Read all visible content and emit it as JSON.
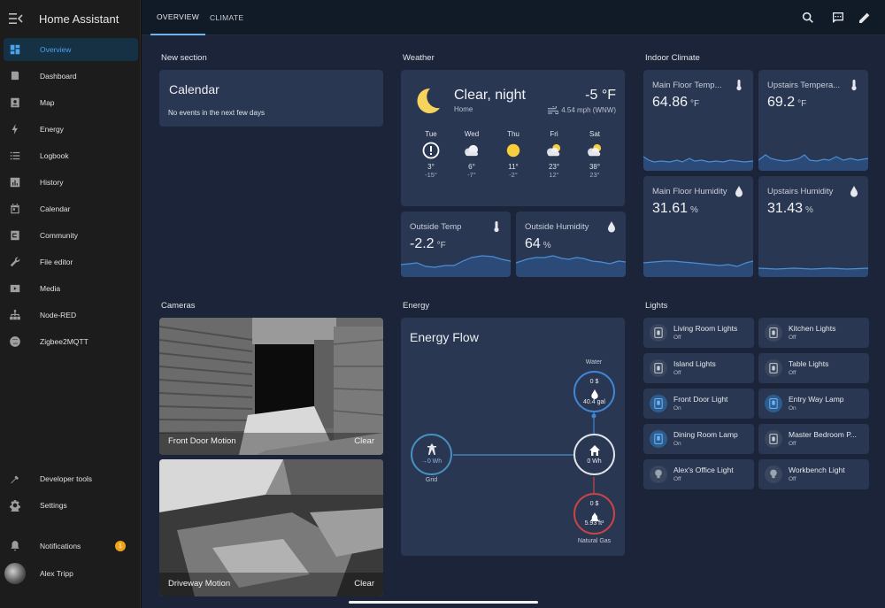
{
  "sidebar": {
    "title": "Home Assistant",
    "items": [
      {
        "label": "Overview",
        "icon": "overview-icon",
        "active": true
      },
      {
        "label": "Dashboard",
        "icon": "dashboard-icon"
      },
      {
        "label": "Map",
        "icon": "map-icon"
      },
      {
        "label": "Energy",
        "icon": "energy-icon"
      },
      {
        "label": "Logbook",
        "icon": "logbook-icon"
      },
      {
        "label": "History",
        "icon": "history-icon"
      },
      {
        "label": "Calendar",
        "icon": "calendar-icon"
      },
      {
        "label": "Community",
        "icon": "community-icon"
      },
      {
        "label": "File editor",
        "icon": "wrench-icon"
      },
      {
        "label": "Media",
        "icon": "media-icon"
      },
      {
        "label": "Node-RED",
        "icon": "sitemap-icon"
      },
      {
        "label": "Zigbee2MQTT",
        "icon": "zigbee-icon"
      }
    ],
    "developer_tools": "Developer tools",
    "settings": "Settings",
    "notifications": "Notifications",
    "notifications_count": "1",
    "user": "Alex Tripp"
  },
  "tabs": [
    {
      "label": "OVERVIEW",
      "active": true
    },
    {
      "label": "CLIMATE",
      "active": false
    }
  ],
  "sections": {
    "new_section": "New section",
    "weather": "Weather",
    "indoor_climate": "Indoor Climate",
    "cameras": "Cameras",
    "energy": "Energy",
    "lights": "Lights"
  },
  "calendar": {
    "title": "Calendar",
    "empty": "No events in the next few days"
  },
  "weather": {
    "condition": "Clear, night",
    "location": "Home",
    "temp": "-5 °F",
    "wind": "4.54 mph (WNW)",
    "forecast": [
      {
        "day": "Tue",
        "icon": "exclamation-icon",
        "high": "3°",
        "low": "-15°"
      },
      {
        "day": "Wed",
        "icon": "cloudy-icon",
        "high": "6°",
        "low": "-7°"
      },
      {
        "day": "Thu",
        "icon": "sunny-icon",
        "high": "11°",
        "low": "-2°"
      },
      {
        "day": "Fri",
        "icon": "partly-cloudy-icon",
        "high": "23°",
        "low": "12°"
      },
      {
        "day": "Sat",
        "icon": "partly-cloudy-icon",
        "high": "38°",
        "low": "23°"
      }
    ]
  },
  "outside": {
    "temp": {
      "name": "Outside Temp",
      "value": "-2.2",
      "unit": "°F"
    },
    "humidity": {
      "name": "Outside Humidity",
      "value": "64",
      "unit": "%"
    }
  },
  "indoor": [
    {
      "name": "Main Floor Temp...",
      "value": "64.86",
      "unit": "°F",
      "icon": "thermometer-icon"
    },
    {
      "name": "Upstairs Tempera...",
      "value": "69.2",
      "unit": "°F",
      "icon": "thermometer-icon"
    },
    {
      "name": "Main Floor Humidity",
      "value": "31.61",
      "unit": "%",
      "icon": "water-percent-icon"
    },
    {
      "name": "Upstairs Humidity",
      "value": "31.43",
      "unit": "%",
      "icon": "water-percent-icon"
    }
  ],
  "cameras": [
    {
      "name": "Front Door Motion",
      "state": "Clear"
    },
    {
      "name": "Driveway Motion",
      "state": "Clear"
    }
  ],
  "energy_flow": {
    "title": "Energy Flow",
    "water_label": "Water",
    "water_cost": "0 $",
    "water_value": "40.4 gal",
    "grid_label": "Grid",
    "grid_value": "0 Wh",
    "home_value": "0 Wh",
    "gas_cost": "0 $",
    "gas_value": "5.93 ft³",
    "gas_label": "Natural Gas"
  },
  "lights": [
    {
      "name": "Living Room Lights",
      "state": "Off",
      "icon": "light-switch-icon"
    },
    {
      "name": "Kitchen Lights",
      "state": "Off",
      "icon": "light-switch-icon"
    },
    {
      "name": "Island Lights",
      "state": "Off",
      "icon": "light-switch-icon"
    },
    {
      "name": "Table Lights",
      "state": "Off",
      "icon": "light-switch-icon"
    },
    {
      "name": "Front Door Light",
      "state": "On",
      "icon": "light-switch-icon"
    },
    {
      "name": "Entry Way Lamp",
      "state": "On",
      "icon": "light-switch-icon"
    },
    {
      "name": "Dining Room Lamp",
      "state": "On",
      "icon": "light-switch-icon"
    },
    {
      "name": "Master Bedroom P...",
      "state": "Off",
      "icon": "light-switch-icon"
    },
    {
      "name": "Alex's Office Light",
      "state": "Off",
      "icon": "bulb-icon"
    },
    {
      "name": "Workbench Light",
      "state": "Off",
      "icon": "bulb-icon"
    }
  ]
}
